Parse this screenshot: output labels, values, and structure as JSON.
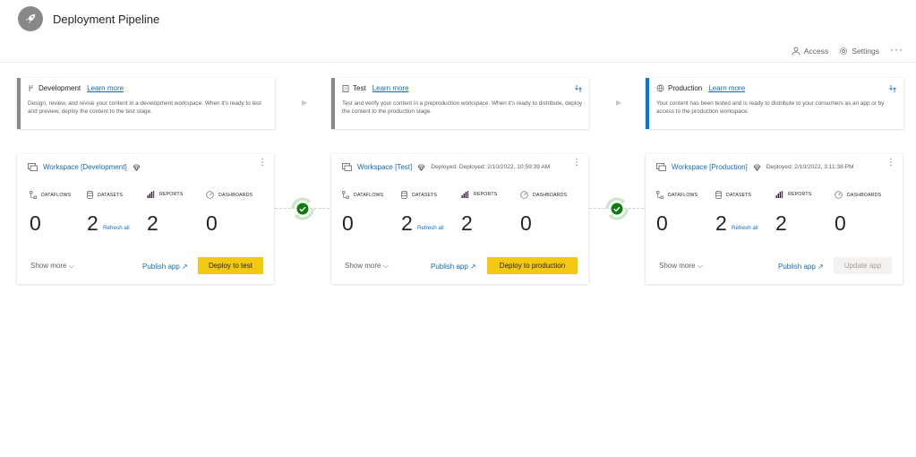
{
  "header": {
    "title": "Deployment Pipeline",
    "logo_icon": "rocket-icon",
    "access_label": "Access",
    "settings_label": "Settings",
    "more_label": "···"
  },
  "colors": {
    "accent_yellow": "#f2c811",
    "link_blue": "#0f6cbd",
    "production_blue": "#0078d4",
    "stage_gray": "#8a8886",
    "success_green": "#107c10"
  },
  "stages": [
    {
      "name": "Development",
      "learn_more": "Learn more",
      "description": "Design, review, and revise your content in a development workspace. When it's ready to test and preview, deploy the content to the test stage."
    },
    {
      "name": "Test",
      "learn_more": "Learn more",
      "description": "Test and verify your content in a preproduction workspace. When it's ready to distribute, deploy the content to the production stage."
    },
    {
      "name": "Production",
      "learn_more": "Learn more",
      "description": "Your content has been tested and is ready to distribute to your consumers as an app or by access to the production workspace."
    }
  ],
  "metric_labels": {
    "dataflows": "DATAFLOWS",
    "datasets": "DATASETS",
    "reports": "REPORTS",
    "dashboards": "DASHBOARDS"
  },
  "cards": [
    {
      "workspace": "Workspace [Development]",
      "deployed": "",
      "dataflows": "0",
      "datasets": "2",
      "reports": "2",
      "dashboards": "0",
      "refresh_all": "Refresh all",
      "show_more": "Show more",
      "publish_app": "Publish app",
      "action": "Deploy to test"
    },
    {
      "workspace": "Workspace [Test]",
      "deployed": "Deployed: Deployed: 2/10/2022, 10:59:39 AM",
      "dataflows": "0",
      "datasets": "2",
      "reports": "2",
      "dashboards": "0",
      "refresh_all": "Refresh all",
      "show_more": "Show more",
      "publish_app": "Publish app",
      "action": "Deploy to production"
    },
    {
      "workspace": "Workspace [Production]",
      "deployed": "Deployed: 2/10/2022, 3:11:38 PM",
      "dataflows": "0",
      "datasets": "2",
      "reports": "2",
      "dashboards": "0",
      "refresh_all": "Refresh all",
      "show_more": "Show more",
      "publish_app": "Publish app",
      "action": "Update app"
    }
  ]
}
